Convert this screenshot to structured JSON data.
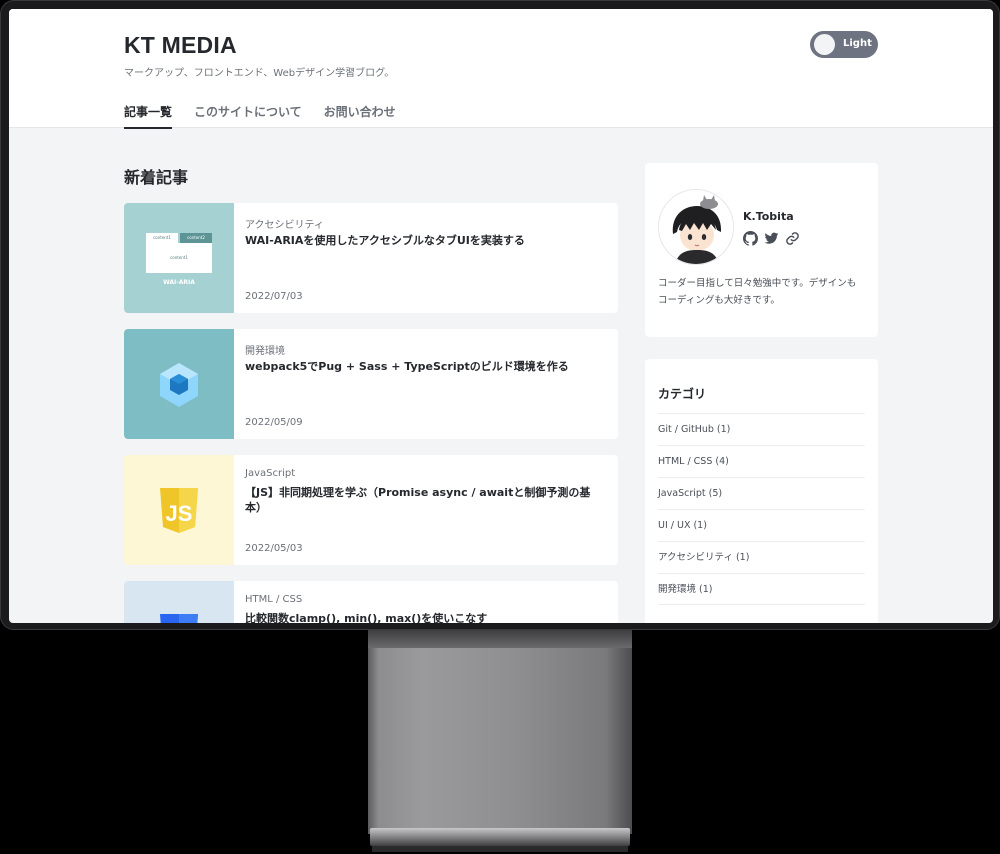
{
  "site": {
    "brand": "KT MEDIA",
    "tagline": "マークアップ、フロントエンド、Webデザイン学習ブログ。",
    "theme_toggle_label": "Light"
  },
  "nav": {
    "items": [
      {
        "label": "記事一覧"
      },
      {
        "label": "このサイトについて"
      },
      {
        "label": "お問い合わせ"
      }
    ]
  },
  "main": {
    "section_title": "新着記事",
    "posts": [
      {
        "category": "アクセシビリティ",
        "title": "WAI-ARIAを使用したアクセシブルなタブUIを実装する",
        "date": "2022/07/03",
        "thumb": {
          "tab1": "content1",
          "tab2": "content2",
          "panel": "content1",
          "label": "WAI-ARIA"
        }
      },
      {
        "category": "開発環境",
        "title": "webpack5でPug + Sass + TypeScriptのビルド環境を作る",
        "date": "2022/05/09",
        "thumb_icon": "webpack-icon"
      },
      {
        "category": "JavaScript",
        "title": "【JS】非同期処理を学ぶ（Promise async / awaitと制御予測の基本）",
        "date": "2022/05/03",
        "thumb_icon": "js-shield-icon"
      },
      {
        "category": "HTML / CSS",
        "title": "比較関数clamp(), min(), max()を使いこなす",
        "date": "",
        "thumb_icon": "css-shield-icon"
      }
    ]
  },
  "sidebar": {
    "profile": {
      "name": "K.Tobita",
      "bio": "コーダー目指して日々勉強中です。デザインもコーディングも大好きです。",
      "social_icons": [
        "github-icon",
        "twitter-icon",
        "link-icon"
      ]
    },
    "categories": {
      "title": "カテゴリ",
      "items": [
        {
          "label": "Git / GitHub (1)"
        },
        {
          "label": "HTML / CSS (4)"
        },
        {
          "label": "JavaScript (5)"
        },
        {
          "label": "UI / UX (1)"
        },
        {
          "label": "アクセシビリティ (1)"
        },
        {
          "label": "開発環境 (1)"
        }
      ]
    }
  },
  "colors": {
    "page_bg": "#f3f4f6",
    "text": "#25282d",
    "muted": "#6b7079",
    "toggle_bg": "#6d7380"
  }
}
